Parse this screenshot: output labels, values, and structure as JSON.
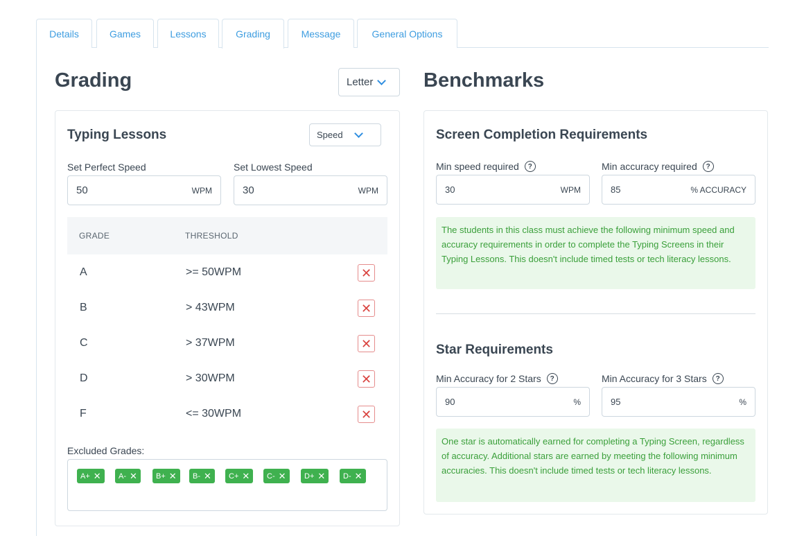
{
  "tabs": [
    {
      "label": "Details"
    },
    {
      "label": "Games"
    },
    {
      "label": "Lessons"
    },
    {
      "label": "Grading"
    },
    {
      "label": "Message"
    },
    {
      "label": "General Options"
    }
  ],
  "active_tab": "Grading",
  "grading": {
    "title": "Grading",
    "scale_select": "Letter",
    "typing_lessons": {
      "title": "Typing Lessons",
      "metric_select": "Speed",
      "perfect_label": "Set Perfect Speed",
      "perfect_value": "50",
      "perfect_unit": "WPM",
      "lowest_label": "Set Lowest Speed",
      "lowest_value": "30",
      "lowest_unit": "WPM",
      "table": {
        "col_grade": "GRADE",
        "col_threshold": "THRESHOLD",
        "rows": [
          {
            "grade": "A",
            "threshold": ">= 50WPM"
          },
          {
            "grade": "B",
            "threshold": "> 43WPM"
          },
          {
            "grade": "C",
            "threshold": "> 37WPM"
          },
          {
            "grade": "D",
            "threshold": "> 30WPM"
          },
          {
            "grade": "F",
            "threshold": "<= 30WPM"
          }
        ],
        "delete_glyph": "✕"
      },
      "excluded_label": "Excluded Grades:",
      "excluded": [
        "A+",
        "A-",
        "B+",
        "B-",
        "C+",
        "C-",
        "D+",
        "D-"
      ],
      "chip_remove_glyph": "✕"
    }
  },
  "benchmarks": {
    "title": "Benchmarks",
    "screen": {
      "title": "Screen Completion Requirements",
      "speed_label": "Min speed required",
      "speed_value": "30",
      "speed_unit": "WPM",
      "accuracy_label": "Min accuracy required",
      "accuracy_value": "85",
      "accuracy_unit": "% ACCURACY",
      "note": "The students in this class must achieve the following minimum speed and accuracy requirements in order to complete the Typing Screens in their Typing Lessons. This doesn't include timed tests or tech literacy lessons."
    },
    "stars": {
      "title": "Star Requirements",
      "two_label": "Min Accuracy for 2 Stars",
      "two_value": "90",
      "two_unit": "%",
      "three_label": "Min Accuracy for 3 Stars",
      "three_value": "95",
      "three_unit": "%",
      "note": "One star is automatically earned for completing a Typing Screen, regardless of accuracy. Additional stars are earned by meeting the following minimum accuracies. This doesn't include timed tests or tech literacy lessons."
    },
    "help_glyph": "?"
  },
  "colors": {
    "accent": "#3e9de0",
    "success_chip": "#3fb14f",
    "note_bg": "#eaf8ea",
    "note_text": "#3a9f3a",
    "delete": "#d9433f"
  }
}
